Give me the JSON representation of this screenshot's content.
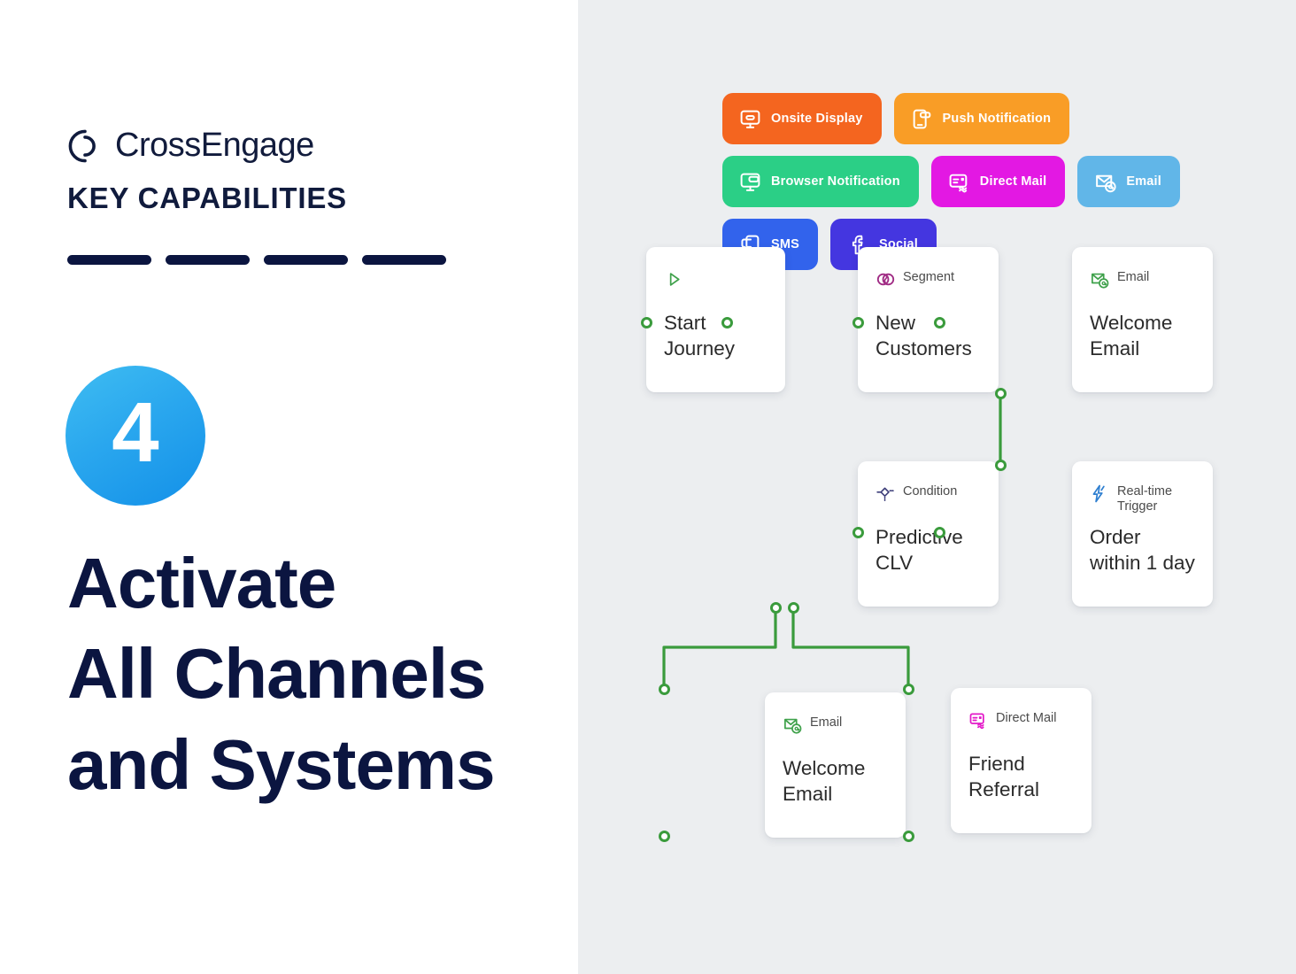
{
  "brand": {
    "logo_icon": "crossengage-circle-logo",
    "name": "CrossEngage",
    "kicker": "KEY CAPABILITIES"
  },
  "badge": {
    "number": "4"
  },
  "headline": {
    "line1": "Activate",
    "line2": "All Channels",
    "line3": "and Systems"
  },
  "colors": {
    "navy": "#0b1540",
    "badge_blue": "#2aa7ee",
    "canvas_bg": "#eceef0",
    "connector_green": "#3a9b3c"
  },
  "channels": [
    {
      "label": "Onsite Display",
      "icon": "monitor-icon",
      "color": "#f4651f"
    },
    {
      "label": "Push Notification",
      "icon": "mobile-push-icon",
      "color": "#f99d26"
    },
    {
      "label": "Browser Notification",
      "icon": "browser-window-icon",
      "color": "#2bcf86"
    },
    {
      "label": "Direct Mail",
      "icon": "direct-mail-card-icon",
      "color": "#e318e3"
    },
    {
      "label": "Email",
      "icon": "envelope-at-icon",
      "color": "#61b6e8"
    },
    {
      "label": "SMS",
      "icon": "sms-phone-icon",
      "color": "#3263ec"
    },
    {
      "label": "Social",
      "icon": "facebook-f-icon",
      "color": "#4436e0"
    }
  ],
  "flow_nodes": [
    {
      "id": "start",
      "type": "",
      "type_icon": "play-triangle-icon",
      "title_line1": "Start",
      "title_line2": "Journey"
    },
    {
      "id": "segment",
      "type": "Segment",
      "type_icon": "venn-segment-icon",
      "title_line1": "New",
      "title_line2": "Customers"
    },
    {
      "id": "email1",
      "type": "Email",
      "type_icon": "envelope-at-icon",
      "title_line1": "Welcome",
      "title_line2": "Email"
    },
    {
      "id": "condition",
      "type": "Condition",
      "type_icon": "diamond-condition-icon",
      "title_line1": "Predictive",
      "title_line2": "CLV"
    },
    {
      "id": "trigger",
      "type": "Real-time Trigger",
      "type_icon": "lightning-bolt-icon",
      "title_line1": "Order",
      "title_line2": "within 1 day"
    },
    {
      "id": "email2",
      "type": "Email",
      "type_icon": "envelope-at-icon",
      "title_line1": "Welcome",
      "title_line2": "Email"
    },
    {
      "id": "mail2",
      "type": "Direct Mail",
      "type_icon": "direct-mail-card-icon",
      "title_line1": "Friend",
      "title_line2": "Referral"
    }
  ]
}
